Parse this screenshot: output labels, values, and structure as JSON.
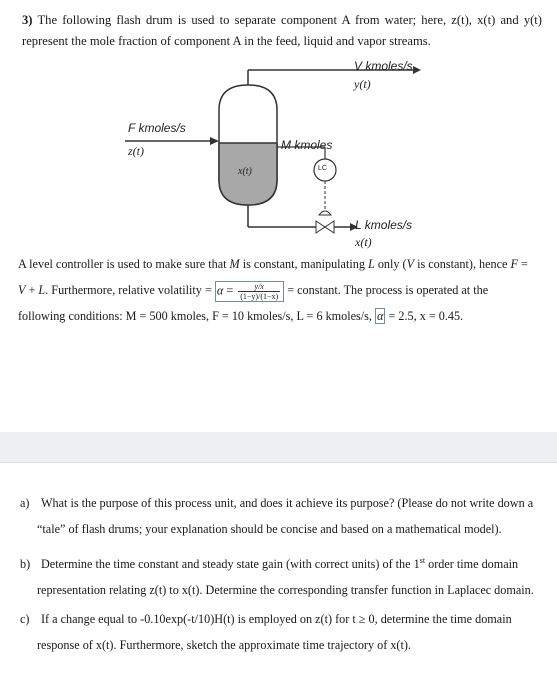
{
  "problem": {
    "number": "3)",
    "intro": "The following flash drum is used to separate component A from water; here, z(t), x(t) and y(t) represent the mole fraction of component A in the feed, liquid and vapor streams."
  },
  "diagram": {
    "vapor_flow_label": "V kmoles/s",
    "vapor_comp_label": "y(t)",
    "feed_flow_label": "F kmoles/s",
    "feed_comp_label": "z(t)",
    "holdup_label": "M kmoles",
    "liquid_comp_in_drum": "x(t)",
    "controller_label": "LC",
    "liquid_flow_label": "L kmoles/s",
    "liquid_comp_label": "x(t)"
  },
  "description": {
    "line1_a": "A level controller is used to make sure that ",
    "line1_M": "M",
    "line1_b": " is constant, manipulating ",
    "line1_L": "L",
    "line1_c": " only (",
    "line1_V": "V",
    "line1_d": " is constant), hence ",
    "line1_F": "F",
    "line1_e": " =",
    "line2_a": "V",
    "line2_b": " + ",
    "line2_c": "L",
    "line2_d": ". Furthermore, relative volatility = ",
    "alpha": "α",
    "eq": " = ",
    "frac_num": "y/x",
    "frac_den": "(1−y)/(1−x)",
    "line2_e": " = constant. The process is operated at the",
    "line3": "following conditions: M = 500 kmoles, F = 10 kmoles/s, L = 6 kmoles/s, ",
    "line3_alpha": "α",
    "line3_end": " = 2.5, x = 0.45."
  },
  "questions": [
    {
      "label": "a)",
      "line1": "What is the purpose of this process unit, and does it achieve its purpose? (Please do not write down a",
      "line2": "“tale” of flash drums; your explanation should be concise and based on a mathematical model)."
    },
    {
      "label": "b)",
      "line1a": "Determine the time constant and steady state gain (with correct units) of the 1",
      "line1sup": "st",
      "line1b": " order time domain",
      "line2": "representation relating z(t) to x(t). Determine the corresponding transfer function in Laplacec domain."
    },
    {
      "label": "c)",
      "line1": "If a change equal to -0.10exp(-t/10)H(t) is employed on z(t) for t ≥ 0, determine the time domain",
      "line2": "response of x(t). Furthermore, sketch the approximate time trajectory of x(t)."
    }
  ]
}
